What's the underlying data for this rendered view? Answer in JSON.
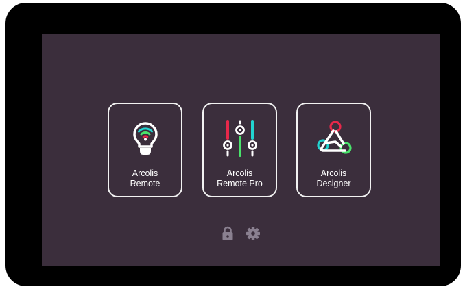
{
  "apps": [
    {
      "line1": "Arcolis",
      "line2": "Remote",
      "icon": "wifi-bulb-icon"
    },
    {
      "line1": "Arcolis",
      "line2": "Remote Pro",
      "icon": "sliders-icon"
    },
    {
      "line1": "Arcolis",
      "line2": "Designer",
      "icon": "triangle-nodes-icon"
    }
  ],
  "footer_icons": [
    "lock-icon",
    "gear-icon"
  ],
  "colors": {
    "screen_bg": "#3b2e3c",
    "bezel": "#000000",
    "tile_border": "#f2f2f2",
    "accent_red": "#e8284a",
    "accent_green": "#49e36b",
    "accent_cyan": "#22d4d0",
    "footer_icon": "#8a8090"
  }
}
